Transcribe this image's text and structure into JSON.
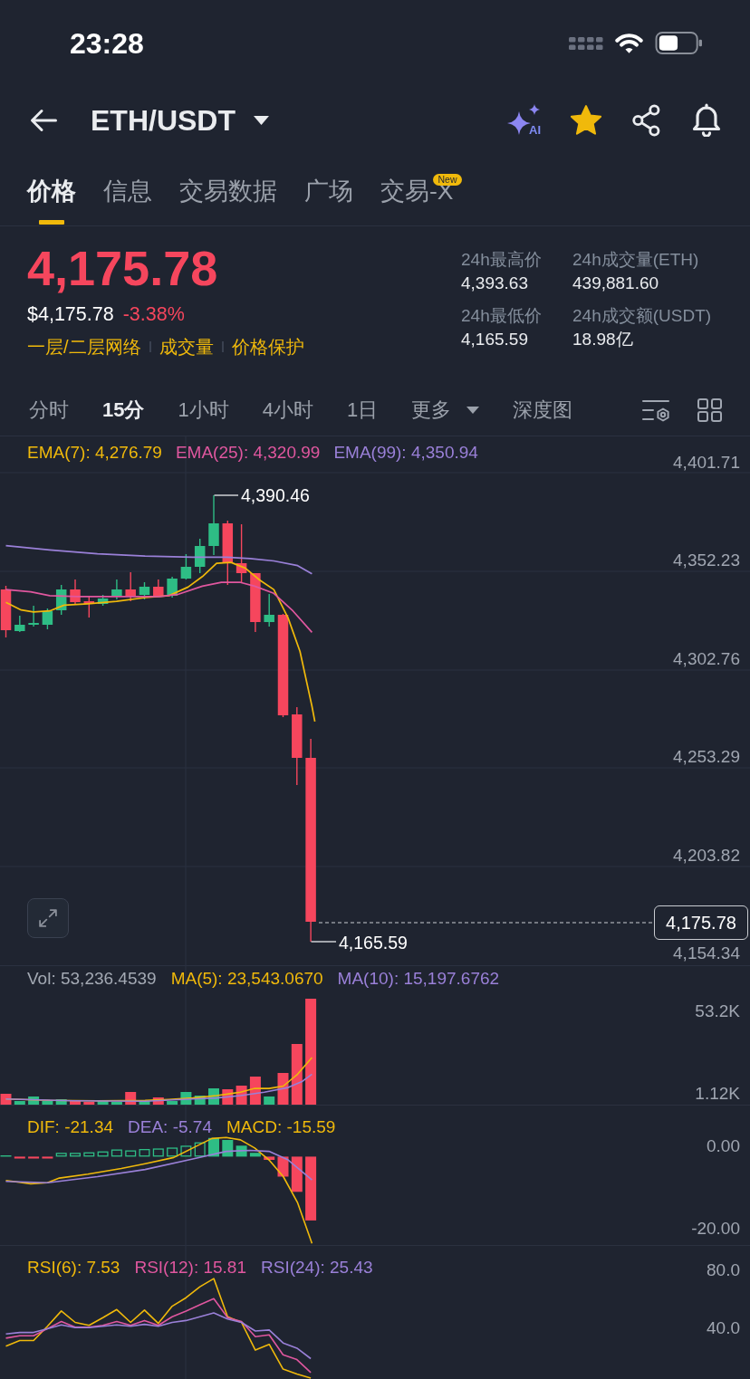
{
  "status_bar": {
    "time": "23:28"
  },
  "header": {
    "pair": "ETH/USDT",
    "ai_label": "AI",
    "favorite": true
  },
  "tabs": [
    {
      "label": "价格",
      "selected": true
    },
    {
      "label": "信息",
      "selected": false
    },
    {
      "label": "交易数据",
      "selected": false
    },
    {
      "label": "广场",
      "selected": false
    },
    {
      "label": "交易-X",
      "selected": false,
      "badge": "New"
    }
  ],
  "price": {
    "last": "4,175.78",
    "usd": "$4,175.78",
    "change": "-3.38%",
    "links": [
      "一层/二层网络",
      "成交量",
      "价格保护"
    ]
  },
  "stats": [
    {
      "label": "24h最高价",
      "value": "4,393.63"
    },
    {
      "label": "24h成交量(ETH)",
      "value": "439,881.60"
    },
    {
      "label": "24h最低价",
      "value": "4,165.59"
    },
    {
      "label": "24h成交额(USDT)",
      "value": "18.98亿"
    }
  ],
  "intervals": [
    {
      "label": "分时",
      "kind": "option",
      "selected": false
    },
    {
      "label": "15分",
      "kind": "option",
      "selected": true
    },
    {
      "label": "1小时",
      "kind": "option",
      "selected": false
    },
    {
      "label": "4小时",
      "kind": "option",
      "selected": false
    },
    {
      "label": "1日",
      "kind": "option",
      "selected": false
    },
    {
      "label": "更多",
      "kind": "dropdown",
      "selected": false
    },
    {
      "label": "深度图",
      "kind": "option",
      "selected": false
    }
  ],
  "price_chart": {
    "legend": [
      {
        "label": "EMA(7): 4,276.79",
        "color": "#f0b90b"
      },
      {
        "label": "EMA(25): 4,320.99",
        "color": "#e0579f"
      },
      {
        "label": "EMA(99): 4,350.94",
        "color": "#9a80d8"
      }
    ],
    "y_axis_labels": [
      "4,401.71",
      "4,352.23",
      "4,302.76",
      "4,253.29",
      "4,203.82",
      "4,154.34"
    ],
    "high_label": "4,390.46",
    "low_label": "4,165.59",
    "last_price_tag": "4,175.78"
  },
  "volume_chart": {
    "legend": [
      {
        "label": "Vol: 53,236.4539",
        "color": "#a3a9b3"
      },
      {
        "label": "MA(5): 23,543.0670",
        "color": "#f0b90b"
      },
      {
        "label": "MA(10): 15,197.6762",
        "color": "#9a80d8"
      }
    ],
    "y_axis_labels": [
      "53.2K",
      "1.12K"
    ]
  },
  "macd_chart": {
    "legend": [
      {
        "label": "DIF: -21.34",
        "color": "#f0b90b"
      },
      {
        "label": "DEA: -5.74",
        "color": "#9a80d8"
      },
      {
        "label": "MACD: -15.59",
        "color": "#f0b90b"
      }
    ],
    "y_axis_labels": [
      "0.00",
      "-20.00"
    ]
  },
  "rsi_chart": {
    "legend": [
      {
        "label": "RSI(6): 7.53",
        "color": "#f0b90b"
      },
      {
        "label": "RSI(12): 15.81",
        "color": "#e0579f"
      },
      {
        "label": "RSI(24): 25.43",
        "color": "#9a80d8"
      }
    ],
    "y_axis_labels": [
      "80.0",
      "40.0"
    ]
  }
}
